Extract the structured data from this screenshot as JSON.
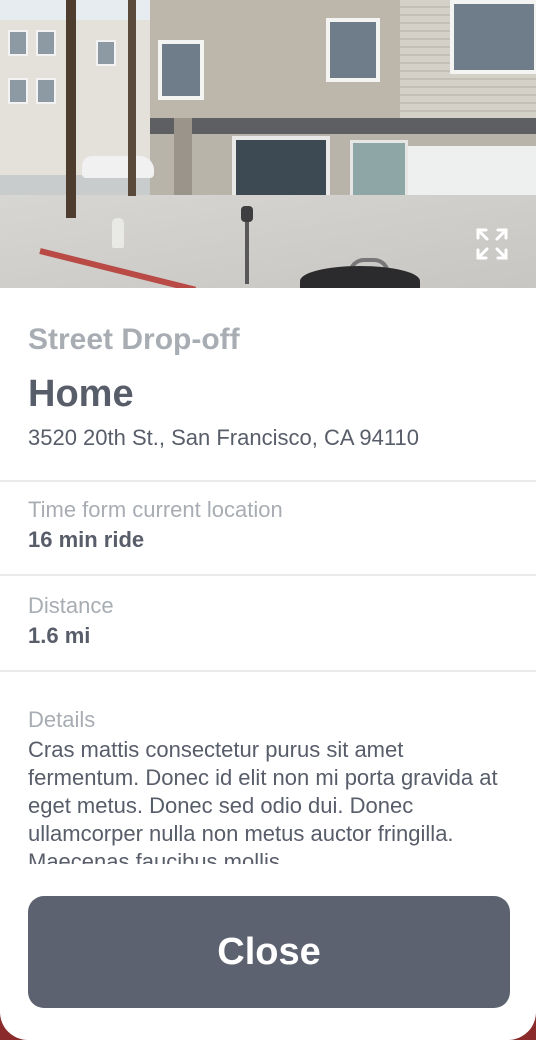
{
  "place": {
    "category": "Street Drop-off",
    "name": "Home",
    "address": "3520 20th St., San Francisco, CA 94110"
  },
  "stats": [
    {
      "label": "Time form current location",
      "value": "16 min ride"
    },
    {
      "label": "Distance",
      "value": "1.6 mi"
    }
  ],
  "details": {
    "label": "Details",
    "text": "Cras mattis consectetur purus sit amet fermentum. Donec id elit non mi porta gravida at eget metus. Donec sed odio dui. Donec ullamcorper nulla non metus auctor fringilla. Maecenas faucibus mollis"
  },
  "actions": {
    "close_label": "Close"
  },
  "icons": {
    "expand": "expand-icon"
  },
  "colors": {
    "button": "#5d6270",
    "primary_text": "#585d6a",
    "muted_text": "#a8adb3",
    "backdrop": "#8a2a2a"
  }
}
